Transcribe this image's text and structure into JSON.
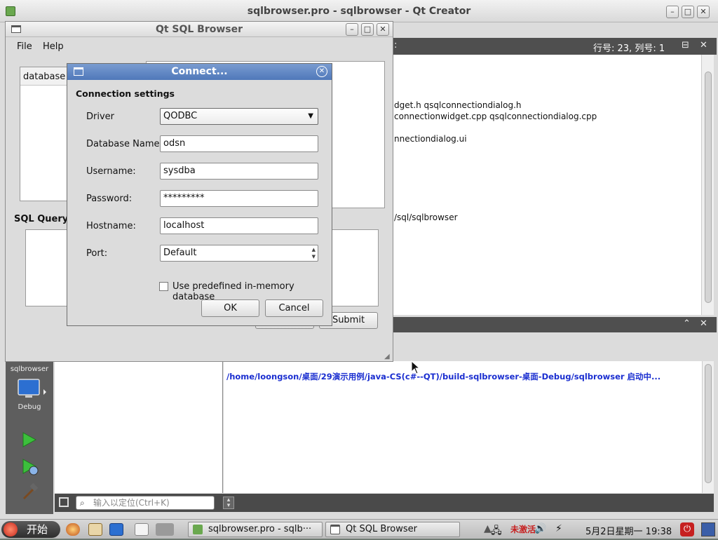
{
  "qtcreator": {
    "title": "sqlbrowser.pro - sqlbrowser - Qt Creator",
    "position": "行号: 23, 列号: 1",
    "editor_lines": [
      "dget.h qsqlconnectiondialog.h",
      "connectionwidget.cpp qsqlconnectiondialog.cpp",
      "nnectiondialog.ui",
      "/sql/sqlbrowser"
    ],
    "mode_label": "sqlbrowser",
    "mode_debug": "Debug",
    "output_message": "/home/loongson/桌面/29演示用例/java-CS(c#--QT)/build-sqlbrowser-桌面-Debug/sqlbrowser 启动中...",
    "locator_placeholder": "输入以定位(Ctrl+K)"
  },
  "sqlbrowser": {
    "title": "Qt SQL Browser",
    "menu": [
      "File",
      "Help"
    ],
    "tree_header": "database",
    "sql_query_label": "SQL Query",
    "submit_label": "Submit"
  },
  "dialog": {
    "title": "Connect...",
    "section": "Connection settings",
    "driver_label": "Driver",
    "driver_value": "QODBC",
    "dbname_label": "Database Name:",
    "dbname_value": "odsn",
    "username_label": "Username:",
    "username_value": "sysdba",
    "password_label": "Password:",
    "password_value": "*********",
    "hostname_label": "Hostname:",
    "hostname_value": "localhost",
    "port_label": "Port:",
    "port_value": "Default",
    "inmemory_label": "Use predefined in-memory database",
    "ok_label": "OK",
    "cancel_label": "Cancel"
  },
  "taskbar": {
    "start_label": "开始",
    "tasks": [
      "sqlbrowser.pro - sqlb···",
      "Qt SQL Browser"
    ],
    "clock": "5月2日星期一 19:38"
  },
  "colors": {
    "dialog_title": "#5b82c2",
    "output_link": "#1a2ed0",
    "panel_dark": "#4f4f4f"
  }
}
